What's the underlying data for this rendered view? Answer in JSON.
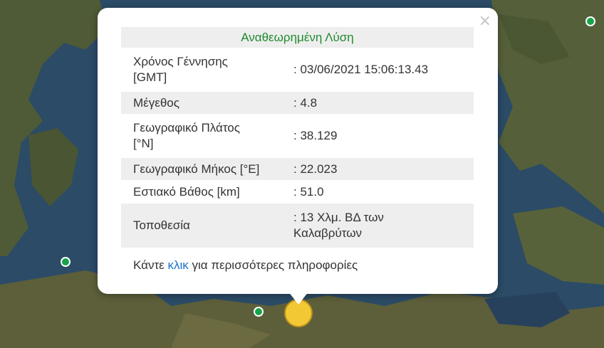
{
  "popup": {
    "title": "Αναθεωρημένη Λύση",
    "close_symbol": "×",
    "rows": [
      {
        "label_line1": "Χρόνος Γέννησης",
        "label_line2": "[GMT]",
        "value": ": 03/06/2021 15:06:13.43"
      },
      {
        "label_line1": "Μέγεθος",
        "label_line2": "",
        "value": ": 4.8"
      },
      {
        "label_line1": "Γεωγραφικό Πλάτος",
        "label_line2": "[°N]",
        "value": ": 38.129"
      },
      {
        "label_line1": "Γεωγραφικό Μήκος [°E]",
        "label_line2": "",
        "value": ": 22.023"
      },
      {
        "label_line1": "Εστιακό Βάθος [km]",
        "label_line2": "",
        "value": ": 51.0"
      },
      {
        "label_line1": "Τοποθεσία",
        "label_line2": "",
        "value": ": 13 Χλμ. ΒΔ των",
        "value_line2": "Καλαβρύτων"
      }
    ],
    "footer_prefix": "Κάντε ",
    "footer_link": "κλικ",
    "footer_suffix": " για περισσότερες πληροφορίες"
  },
  "colors": {
    "title_green": "#1f8a2e",
    "link_blue": "#1a73c8",
    "marker_green": "#16a34a",
    "marker_yellow": "#f2c935"
  }
}
